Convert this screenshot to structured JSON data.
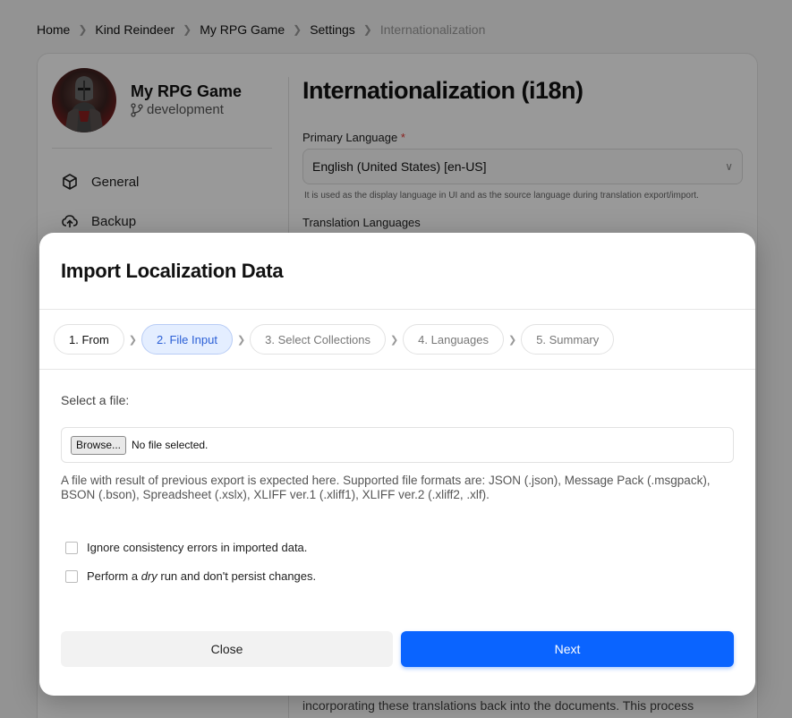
{
  "breadcrumb": {
    "items": [
      "Home",
      "Kind Reindeer",
      "My RPG Game",
      "Settings"
    ],
    "current": "Internationalization"
  },
  "project": {
    "name": "My RPG Game",
    "branch": "development"
  },
  "sidebar": {
    "items": [
      {
        "label": "General",
        "icon": "cube-icon"
      },
      {
        "label": "Backup",
        "icon": "cloud-upload-icon"
      }
    ]
  },
  "page": {
    "title": "Internationalization (i18n)",
    "primary_language_label": "Primary Language",
    "required_mark": "*",
    "primary_language_value": "English (United States) [en-US]",
    "primary_language_help": "It is used as the display language in UI and as the source language during translation export/import.",
    "translation_languages_label": "Translation Languages",
    "bottom_text": "incorporating these translations back into the documents. This process"
  },
  "modal": {
    "title": "Import Localization Data",
    "steps": [
      {
        "label": "1. From",
        "state": "done"
      },
      {
        "label": "2. File Input",
        "state": "active"
      },
      {
        "label": "3. Select Collections",
        "state": "pending"
      },
      {
        "label": "4. Languages",
        "state": "pending"
      },
      {
        "label": "5. Summary",
        "state": "pending"
      }
    ],
    "file_label": "Select a file:",
    "browse_label": "Browse...",
    "file_status": "No file selected.",
    "file_help": "A file with result of previous export is expected here. Supported file formats are: JSON (.json), Message Pack (.msgpack), BSON (.bson), Spreadsheet (.xslx), XLIFF ver.1 (.xliff1), XLIFF ver.2 (.xliff2, .xlf).",
    "checkboxes": {
      "ignore_errors": {
        "label": "Ignore consistency errors in imported data.",
        "checked": false
      },
      "dry_run": {
        "prefix": "Perform a ",
        "emphasis": "dry",
        "suffix": " run and don't persist changes.",
        "checked": false
      }
    },
    "close_label": "Close",
    "next_label": "Next"
  },
  "colors": {
    "accent": "#0a64ff",
    "active_step_bg": "#e4eeff",
    "active_step_text": "#2a5fd6",
    "required": "#e53935"
  }
}
